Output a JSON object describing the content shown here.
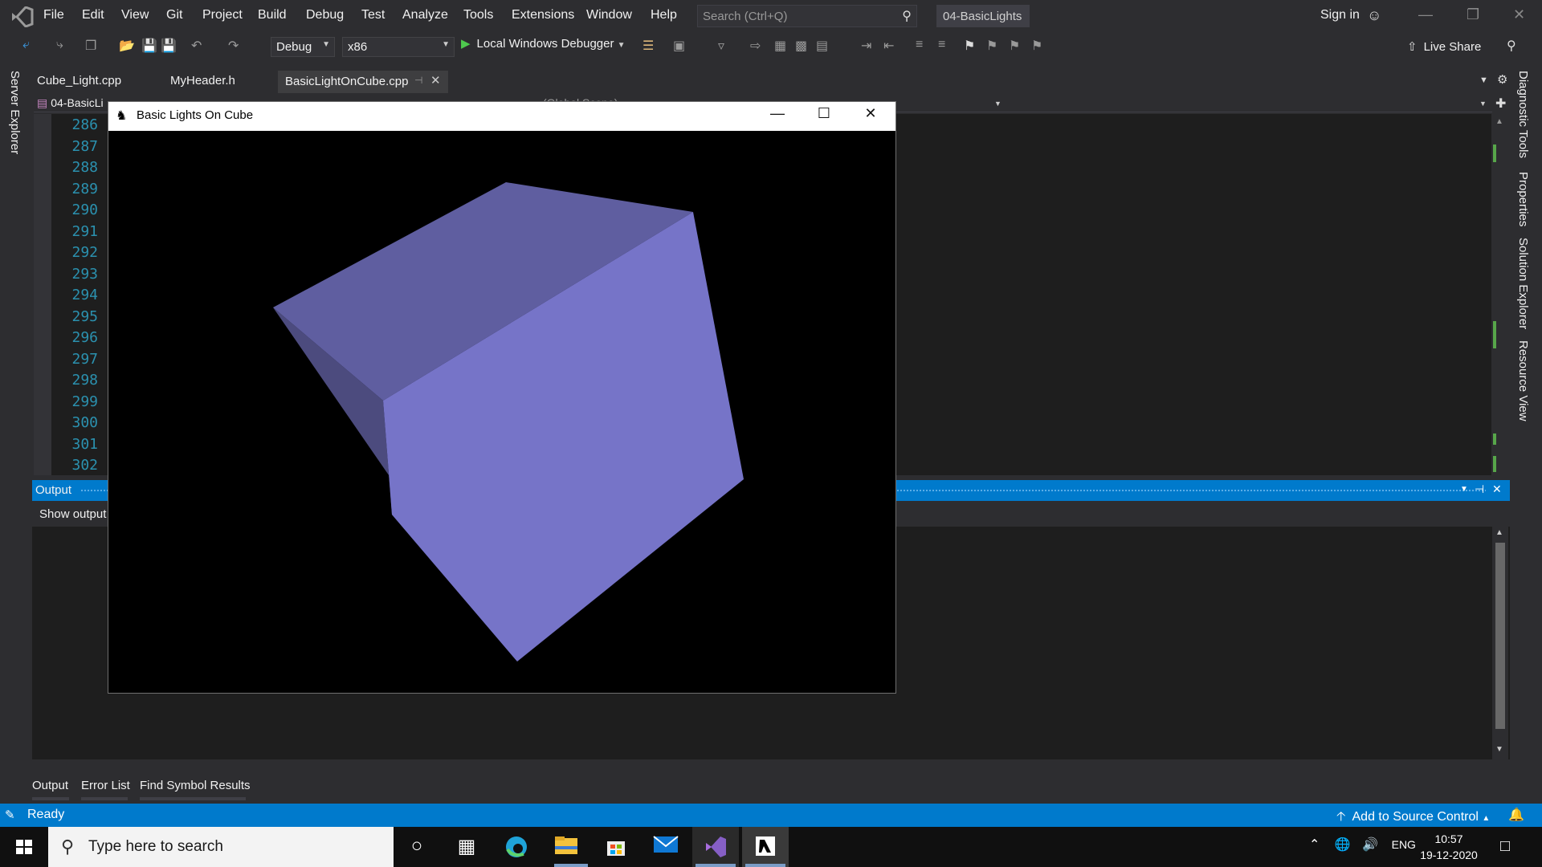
{
  "menubar": {
    "items": [
      "File",
      "Edit",
      "View",
      "Git",
      "Project",
      "Build",
      "Debug",
      "Test",
      "Analyze",
      "Tools",
      "Extensions",
      "Window",
      "Help"
    ],
    "search_placeholder": "Search (Ctrl+Q)",
    "solution_name": "04-BasicLights",
    "sign_in": "Sign in"
  },
  "toolbar": {
    "config": "Debug",
    "platform": "x86",
    "run_label": "Local Windows Debugger",
    "live_share": "Live Share"
  },
  "side_panels": {
    "left": [
      "Server Explorer"
    ],
    "right": [
      "Diagnostic Tools",
      "Properties",
      "Solution Explorer",
      "Resource View"
    ]
  },
  "doc_tabs": [
    {
      "label": "Cube_Light.cpp"
    },
    {
      "label": "MyHeader.h"
    },
    {
      "label": "BasicLightOnCube.cpp",
      "active": true
    }
  ],
  "navbar": {
    "project": "04-BasicLi",
    "scope": "(Global Scope)"
  },
  "editor": {
    "line_numbers": [
      "286",
      "287",
      "288",
      "289",
      "290",
      "291",
      "292",
      "293",
      "294",
      "295",
      "296",
      "297",
      "298",
      "299",
      "300",
      "301",
      "302"
    ]
  },
  "output_panel": {
    "title": "Output",
    "show_output_from": "Show output"
  },
  "bottom_tabs": [
    "Output",
    "Error List",
    "Find Symbol Results"
  ],
  "status": {
    "text": "Ready",
    "source_control": "Add to Source Control"
  },
  "taskbar": {
    "search_placeholder": "Type here to search",
    "language": "ENG",
    "time": "10:57",
    "date": "19-12-2020"
  },
  "app_window": {
    "title": "Basic Lights On Cube",
    "scene": {
      "background": "#000000",
      "object": "cube",
      "top_face_color": "#5f5ea0",
      "front_face_color": "#7674c8",
      "side_face_color": "#4c4b7e"
    }
  },
  "colors": {
    "accent": "#007acc",
    "editor_bg": "#1e1e1e",
    "chrome_bg": "#2d2d30",
    "line_number": "#2b91af"
  }
}
